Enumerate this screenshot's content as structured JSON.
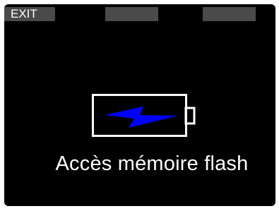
{
  "softkeys": {
    "left_label": "EXIT",
    "center_label": "",
    "right_label": ""
  },
  "status": {
    "message": "Accès mémoire flash"
  },
  "battery_icon": {
    "icon": "battery-charging-icon",
    "outline_color": "#ffffff",
    "bolt_color": "#0000ff"
  },
  "colors": {
    "screen_background": "#000000",
    "softkey_background": "#4a4a4a",
    "text": "#ffffff"
  }
}
